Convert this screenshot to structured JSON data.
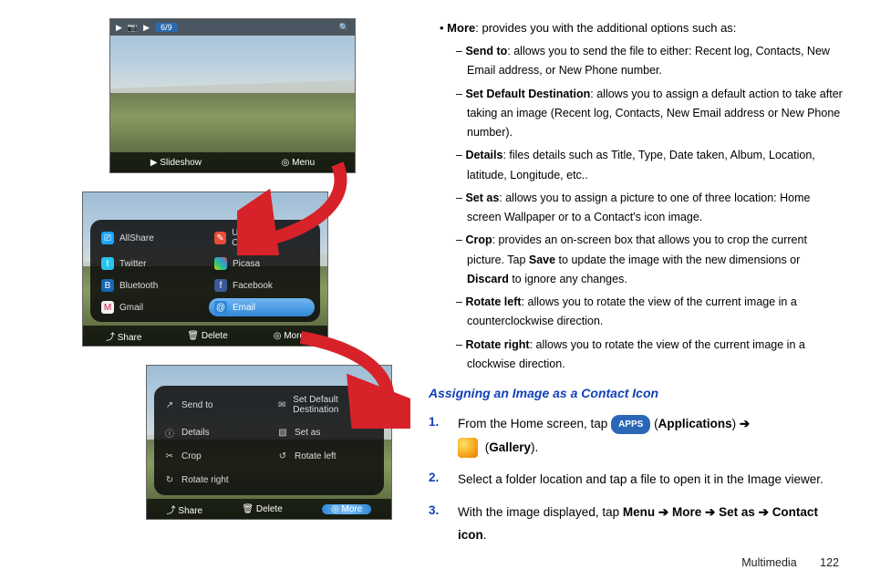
{
  "screenshots": {
    "top": {
      "breadcrumb_sep1": "▶",
      "breadcrumb_camera": "📷",
      "breadcrumb_sep2": "▶",
      "counter": "6/9",
      "search": "🔍",
      "bottom_slideshow_icon": "▶",
      "bottom_slideshow": "Slideshow",
      "bottom_menu_icon": "◎",
      "bottom_menu": "Menu"
    },
    "middle": {
      "items": [
        {
          "icon": "allshare",
          "label": "AllShare"
        },
        {
          "icon": "uc",
          "label": "Universal Composer"
        },
        {
          "icon": "twitter",
          "label": "Twitter"
        },
        {
          "icon": "picasa",
          "label": "Picasa"
        },
        {
          "icon": "bluetooth",
          "label": "Bluetooth"
        },
        {
          "icon": "facebook",
          "label": "Facebook"
        },
        {
          "icon": "gmail",
          "label": "Gmail"
        },
        {
          "icon": "email",
          "label": "Email"
        }
      ],
      "bottom_share_icon": "⤴",
      "bottom_share": "Share",
      "bottom_delete_icon": "🗑",
      "bottom_delete": "Delete",
      "bottom_more_icon": "◎",
      "bottom_more": "More"
    },
    "bottom": {
      "items": [
        {
          "icon": "↗",
          "label": "Send to"
        },
        {
          "icon": "✉",
          "label": "Set Default Destination"
        },
        {
          "icon": "ⓘ",
          "label": "Details"
        },
        {
          "icon": "🖼",
          "label": "Set as"
        },
        {
          "icon": "✂",
          "label": "Crop"
        },
        {
          "icon": "↺",
          "label": "Rotate left"
        },
        {
          "icon": "↻",
          "label": "Rotate right"
        }
      ],
      "bottom_share_icon": "⤴",
      "bottom_share": "Share",
      "bottom_delete_icon": "🗑",
      "bottom_delete": "Delete",
      "bottom_more_icon": "◎",
      "bottom_more": "More"
    }
  },
  "doc": {
    "more_label": "More",
    "more_desc": ": provides you with the additional options such as:",
    "sendto_label": "Send to",
    "sendto_desc": ": allows you to send the file to either: Recent log, Contacts, New Email address, or New Phone number.",
    "sdd_label": "Set Default Destination",
    "sdd_desc": ": allows you to assign a default action to take after taking an image (Recent log, Contacts, New Email address or New Phone number).",
    "details_label": "Details",
    "details_desc": ": files details such as Title, Type, Date taken, Album, Location, latitude, Longitude, etc..",
    "setas_label": "Set as",
    "setas_desc": ": allows you to assign a picture to one of three location: Home screen Wallpaper or to a Contact's icon image.",
    "crop_label": "Crop",
    "crop_desc_a": ": provides an on-screen box that allows you to crop the current picture. Tap ",
    "crop_save": "Save",
    "crop_desc_b": " to update the image with the new dimensions or ",
    "crop_discard": "Discard",
    "crop_desc_c": " to ignore any changes.",
    "rl_label": "Rotate left",
    "rl_desc": ": allows you to rotate the view of the current image in a counterclockwise direction.",
    "rr_label": "Rotate right",
    "rr_desc": ": allows you to rotate the view of the current image in a clockwise direction.",
    "subhead": "Assigning an Image as a Contact Icon",
    "step1_num": "1.",
    "step1_a": "From the Home screen, tap ",
    "step1_apps": "APPS",
    "step1_b": " (",
    "step1_apps_word": "Applications",
    "step1_c": ") ",
    "arrow": "➔",
    "step1_d": " (",
    "step1_gallery": "Gallery",
    "step1_e": ").",
    "step2_num": "2.",
    "step2": "Select a folder location and tap a file to open it in the Image viewer.",
    "step3_num": "3.",
    "step3_a": "With the image displayed, tap ",
    "step3_menu": "Menu",
    "step3_more": "More",
    "step3_setas": "Set as",
    "step3_contact": "Contact icon",
    "step3_period": ".",
    "footer_section": "Multimedia",
    "footer_page": "122"
  }
}
